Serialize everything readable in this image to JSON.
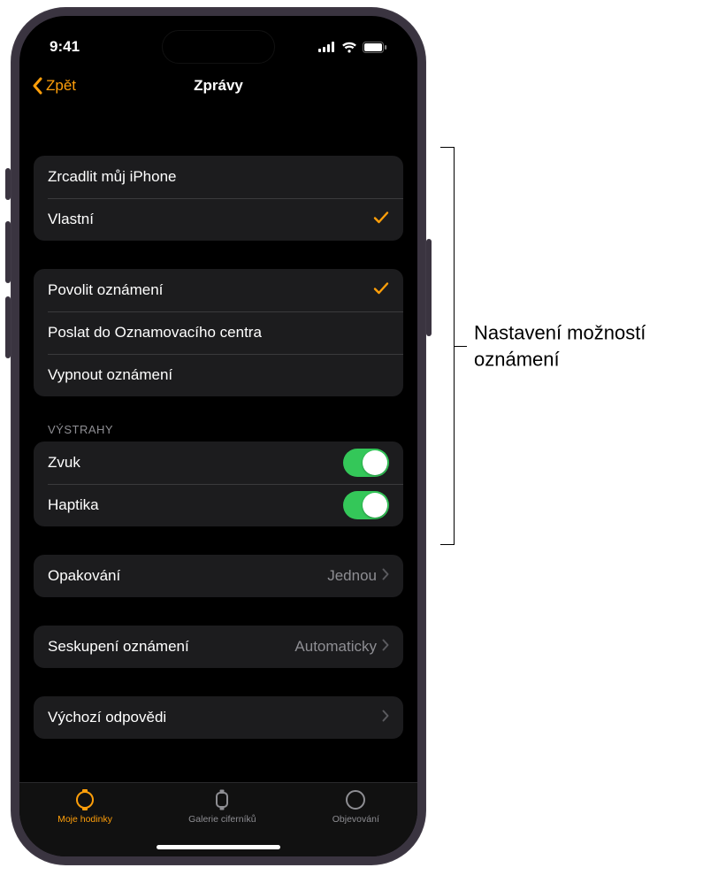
{
  "status": {
    "time": "9:41"
  },
  "nav": {
    "back": "Zpět",
    "title": "Zprávy"
  },
  "group1": {
    "mirror": "Zrcadlit můj iPhone",
    "custom": "Vlastní"
  },
  "group2": {
    "allow": "Povolit oznámení",
    "send_nc": "Poslat do Oznamovacího centra",
    "off": "Vypnout oznámení"
  },
  "alerts": {
    "header": "VÝSTRAHY",
    "sound": "Zvuk",
    "haptics": "Haptika"
  },
  "repeat": {
    "label": "Opakování",
    "value": "Jednou"
  },
  "grouping": {
    "label": "Seskupení oznámení",
    "value": "Automaticky"
  },
  "default_replies": {
    "label": "Výchozí odpovědi"
  },
  "tabs": {
    "watch": "Moje hodinky",
    "gallery": "Galerie ciferníků",
    "discover": "Objevování"
  },
  "callout": "Nastavení možností oznámení"
}
